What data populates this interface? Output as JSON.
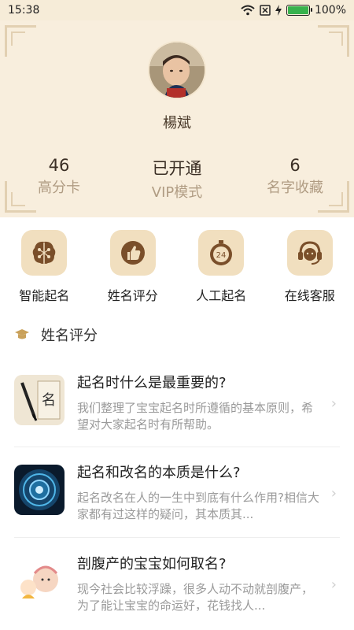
{
  "status_bar": {
    "time": "15:38",
    "battery": "100%"
  },
  "profile": {
    "name": "楊斌"
  },
  "stats": [
    {
      "value": "46",
      "label": "高分卡"
    },
    {
      "value": "已开通",
      "label": "VIP模式"
    },
    {
      "value": "6",
      "label": "名字收藏"
    }
  ],
  "features": [
    {
      "label": "智能起名",
      "icon": "brain-icon"
    },
    {
      "label": "姓名评分",
      "icon": "thumbs-up-icon"
    },
    {
      "label": "人工起名",
      "icon": "timer-24-icon"
    },
    {
      "label": "在线客服",
      "icon": "headset-icon"
    }
  ],
  "section": {
    "title": "姓名评分",
    "icon": "graduation-cap-icon"
  },
  "articles": [
    {
      "title": "起名时什么是最重要的?",
      "desc": "我们整理了宝宝起名时所遵循的基本原则，希望对大家起名时有所帮助。"
    },
    {
      "title": "起名和改名的本质是什么?",
      "desc": "起名改名在人的一生中到底有什么作用?相信大家都有过这样的疑问，其本质其..."
    },
    {
      "title": "剖腹产的宝宝如何取名?",
      "desc": "现今社会比较浮躁，很多人动不动就剖腹产，为了能让宝宝的命运好，花钱找人..."
    }
  ],
  "colors": {
    "header_bg": "#f8eedd",
    "icon_bg": "#f1dfbf",
    "icon_fg": "#7a4f2a",
    "accent": "#c9a15a"
  }
}
